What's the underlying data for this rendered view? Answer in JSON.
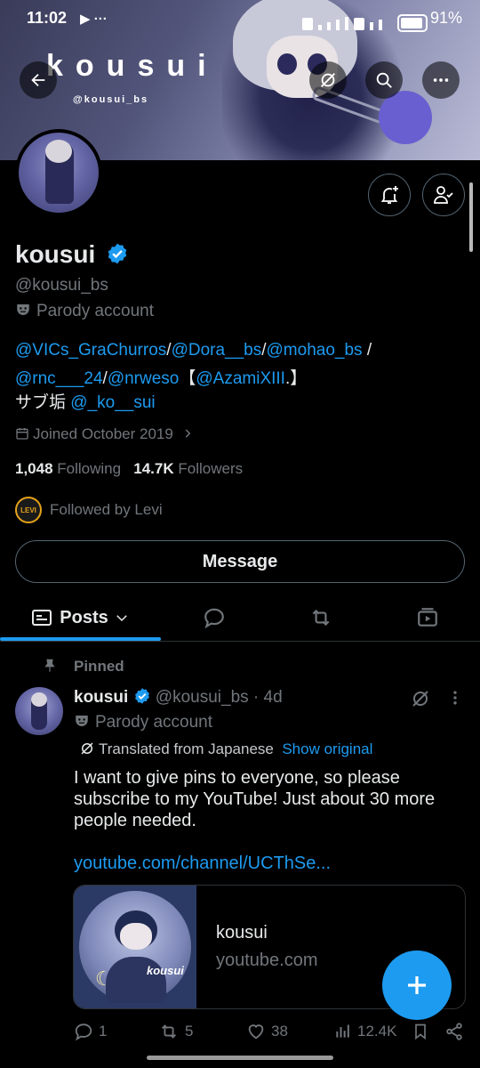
{
  "status_bar": {
    "time": "11:02",
    "battery": "91%"
  },
  "banner": {
    "brand": "kousui",
    "brand_handle": "@kousui_bs"
  },
  "profile": {
    "name": "kousui",
    "handle": "@kousui_bs",
    "label": "Parody account",
    "bio_line1": [
      {
        "t": "@VICs_GraChurros",
        "link": true
      },
      {
        "t": "/",
        "link": false
      },
      {
        "t": "@Dora__bs",
        "link": true
      },
      {
        "t": "/",
        "link": false
      },
      {
        "t": "@mohao_bs",
        "link": true
      },
      {
        "t": " /",
        "link": false
      }
    ],
    "bio_line2": [
      {
        "t": "@rnc___24",
        "link": true
      },
      {
        "t": "/",
        "link": false
      },
      {
        "t": "@nrweso",
        "link": true
      },
      {
        "t": "【",
        "link": false
      },
      {
        "t": "@AzamiXIII",
        "link": true
      },
      {
        "t": ".】",
        "link": false
      }
    ],
    "bio_line3_prefix": "サブ垢 ",
    "bio_line3_link": "@_ko__sui",
    "joined": "Joined October 2019",
    "following_count": "1,048",
    "following_label": "Following",
    "followers_count": "14.7K",
    "followers_label": "Followers",
    "followed_by": "Followed by Levi",
    "followed_by_badge": "LEVI",
    "message_button": "Message"
  },
  "tabs": {
    "posts": "Posts"
  },
  "pinned_post": {
    "pinned_label": "Pinned",
    "author": "kousui",
    "handle": "@kousui_bs",
    "time": "· 4d",
    "label": "Parody account",
    "translated": "Translated from Japanese",
    "show_original": "Show original",
    "text": "I want to give pins to everyone, so please subscribe to my YouTube! Just about 30 more people needed.",
    "link": "youtube.com/channel/UCThSe...",
    "card_title": "kousui",
    "card_domain": "youtube.com",
    "card_thumb_text": "kousui",
    "replies": "1",
    "reposts": "5",
    "likes": "38",
    "views": "12.4K"
  },
  "colors": {
    "accent": "#1d9bf0",
    "muted": "#71767b",
    "background": "#000000"
  },
  "icons": [
    "back-arrow-icon",
    "grok-icon",
    "search-icon",
    "more-icon",
    "bell-plus-icon",
    "following-person-icon",
    "verified-badge-icon",
    "parody-mask-icon",
    "calendar-icon",
    "chevron-right-icon",
    "chevron-down-icon",
    "media-icon",
    "repost-icon",
    "video-icon",
    "pin-icon",
    "translate-icon",
    "reply-icon",
    "like-icon",
    "views-icon",
    "bookmark-icon",
    "share-icon",
    "plus-icon"
  ]
}
